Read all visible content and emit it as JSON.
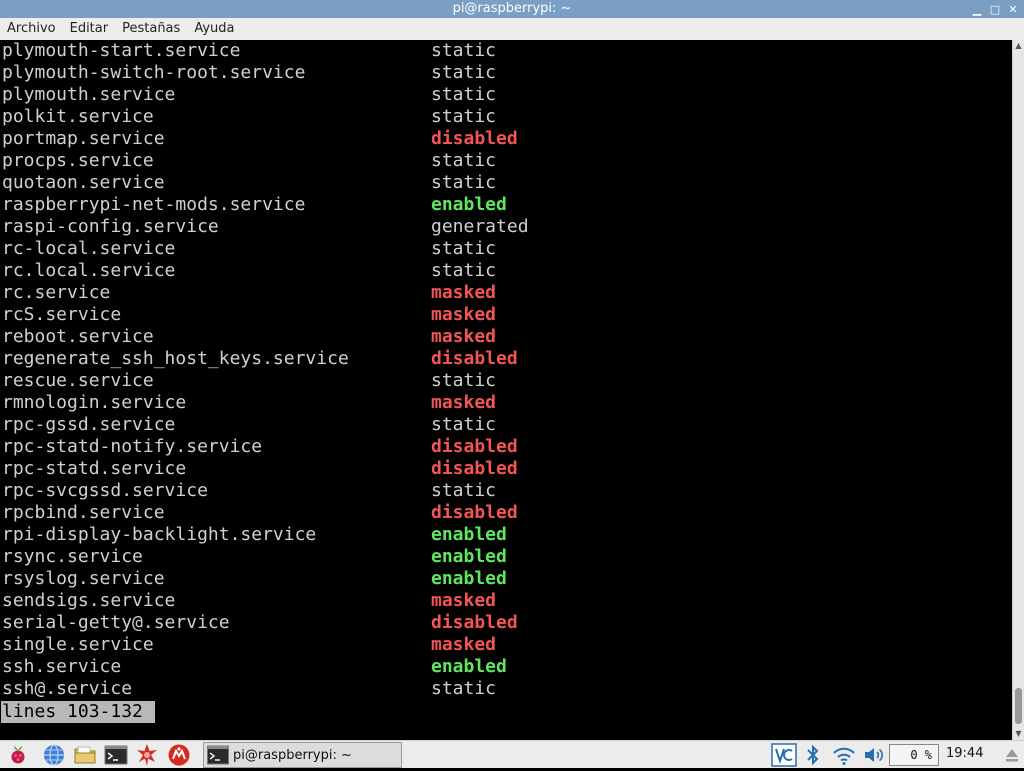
{
  "window": {
    "title": "pi@raspberrypi: ~",
    "minimize_glyph": "▁",
    "maximize_glyph": "□",
    "close_glyph": "✕"
  },
  "menu": [
    "Archivo",
    "Editar",
    "Pestañas",
    "Ayuda"
  ],
  "terminal": {
    "rows": [
      {
        "service": "plymouth-start.service",
        "state": "static"
      },
      {
        "service": "plymouth-switch-root.service",
        "state": "static"
      },
      {
        "service": "plymouth.service",
        "state": "static"
      },
      {
        "service": "polkit.service",
        "state": "static"
      },
      {
        "service": "portmap.service",
        "state": "disabled"
      },
      {
        "service": "procps.service",
        "state": "static"
      },
      {
        "service": "quotaon.service",
        "state": "static"
      },
      {
        "service": "raspberrypi-net-mods.service",
        "state": "enabled"
      },
      {
        "service": "raspi-config.service",
        "state": "generated"
      },
      {
        "service": "rc-local.service",
        "state": "static"
      },
      {
        "service": "rc.local.service",
        "state": "static"
      },
      {
        "service": "rc.service",
        "state": "masked"
      },
      {
        "service": "rcS.service",
        "state": "masked"
      },
      {
        "service": "reboot.service",
        "state": "masked"
      },
      {
        "service": "regenerate_ssh_host_keys.service",
        "state": "disabled"
      },
      {
        "service": "rescue.service",
        "state": "static"
      },
      {
        "service": "rmnologin.service",
        "state": "masked"
      },
      {
        "service": "rpc-gssd.service",
        "state": "static"
      },
      {
        "service": "rpc-statd-notify.service",
        "state": "disabled"
      },
      {
        "service": "rpc-statd.service",
        "state": "disabled"
      },
      {
        "service": "rpc-svcgssd.service",
        "state": "static"
      },
      {
        "service": "rpcbind.service",
        "state": "disabled"
      },
      {
        "service": "rpi-display-backlight.service",
        "state": "enabled"
      },
      {
        "service": "rsync.service",
        "state": "enabled"
      },
      {
        "service": "rsyslog.service",
        "state": "enabled"
      },
      {
        "service": "sendsigs.service",
        "state": "masked"
      },
      {
        "service": "serial-getty@.service",
        "state": "disabled"
      },
      {
        "service": "single.service",
        "state": "masked"
      },
      {
        "service": "ssh.service",
        "state": "enabled"
      },
      {
        "service": "ssh@.service",
        "state": "static"
      }
    ],
    "pager_status": "lines 103-132"
  },
  "state_colors": {
    "static": "#d0d0d0",
    "generated": "#d0d0d0",
    "disabled": "#f25555",
    "masked": "#f25555",
    "enabled": "#5ee85e"
  },
  "taskbar": {
    "launchers": [
      "raspberry-menu-icon",
      "web-browser-icon",
      "file-manager-icon",
      "terminal-icon",
      "mathematica-icon",
      "wolfram-icon"
    ],
    "task_label": "pi@raspberrypi: ~",
    "cpu_label": "0 %",
    "clock": "19:44",
    "tray_icons": [
      "vnc-icon",
      "bluetooth-icon",
      "wifi-icon",
      "volume-icon"
    ]
  }
}
